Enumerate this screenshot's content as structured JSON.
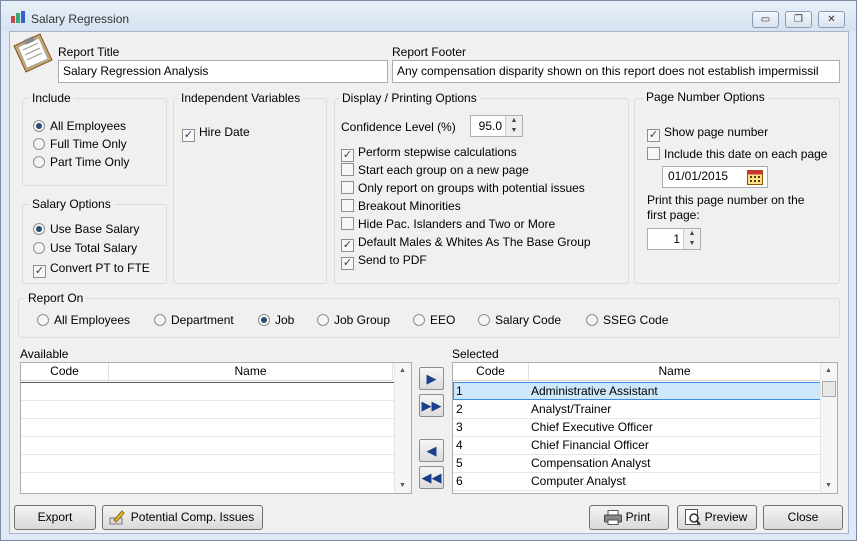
{
  "window": {
    "title": "Salary Regression",
    "min": "▭",
    "restore": "❐",
    "close": "✕"
  },
  "report_title": {
    "label": "Report Title",
    "value": "Salary Regression Analysis"
  },
  "report_footer": {
    "label": "Report Footer",
    "value": "Any compensation disparity shown on this report does not establish impermissil"
  },
  "include": {
    "title": "Include",
    "options": [
      "All Employees",
      "Full Time Only",
      "Part Time Only"
    ],
    "selected": 0
  },
  "salary_options": {
    "title": "Salary Options",
    "options": [
      "Use Base Salary",
      "Use Total Salary"
    ],
    "selected": 0,
    "convert_label": "Convert PT to FTE",
    "convert_checked": true
  },
  "independent": {
    "title": "Independent Variables",
    "hire_date_label": "Hire Date",
    "hire_date_checked": true
  },
  "display": {
    "title": "Display / Printing Options",
    "confidence_label": "Confidence Level (%)",
    "confidence_value": "95.0",
    "options": [
      {
        "label": "Perform stepwise calculations",
        "checked": true
      },
      {
        "label": "Start each group on a new page",
        "checked": false
      },
      {
        "label": "Only report on groups with potential issues",
        "checked": false
      },
      {
        "label": "Breakout Minorities",
        "checked": false
      },
      {
        "label": "Hide Pac. Islanders and Two or More",
        "checked": false
      },
      {
        "label": "Default Males & Whites As The Base Group",
        "checked": true
      },
      {
        "label": "Send to PDF",
        "checked": true
      }
    ]
  },
  "page_number": {
    "title": "Page Number Options",
    "show_label": "Show page number",
    "show_checked": true,
    "include_date_label": "Include this date on each page",
    "include_date_checked": false,
    "date_value": "01/01/2015",
    "first_page_label": "Print this page number on the first page:",
    "first_page_value": "1"
  },
  "report_on": {
    "title": "Report On",
    "options": [
      "All Employees",
      "Department",
      "Job",
      "Job Group",
      "EEO",
      "Salary Code",
      "SSEG Code"
    ],
    "selected": 2
  },
  "available": {
    "label": "Available",
    "col_code": "Code",
    "col_name": "Name"
  },
  "selected_list": {
    "label": "Selected",
    "col_code": "Code",
    "col_name": "Name",
    "rows": [
      {
        "code": "1",
        "name": "Administrative Assistant"
      },
      {
        "code": "2",
        "name": "Analyst/Trainer"
      },
      {
        "code": "3",
        "name": "Chief Executive Officer"
      },
      {
        "code": "4",
        "name": "Chief Financial Officer"
      },
      {
        "code": "5",
        "name": "Compensation Analyst"
      },
      {
        "code": "6",
        "name": "Computer Analyst"
      }
    ]
  },
  "buttons": {
    "export": "Export",
    "issues": "Potential Comp. Issues",
    "print": "Print",
    "preview": "Preview",
    "close": "Close"
  },
  "colors": {
    "accent": "#2a4d74",
    "selection": "#cde8fb",
    "window_frame": "#dfe9f5"
  }
}
